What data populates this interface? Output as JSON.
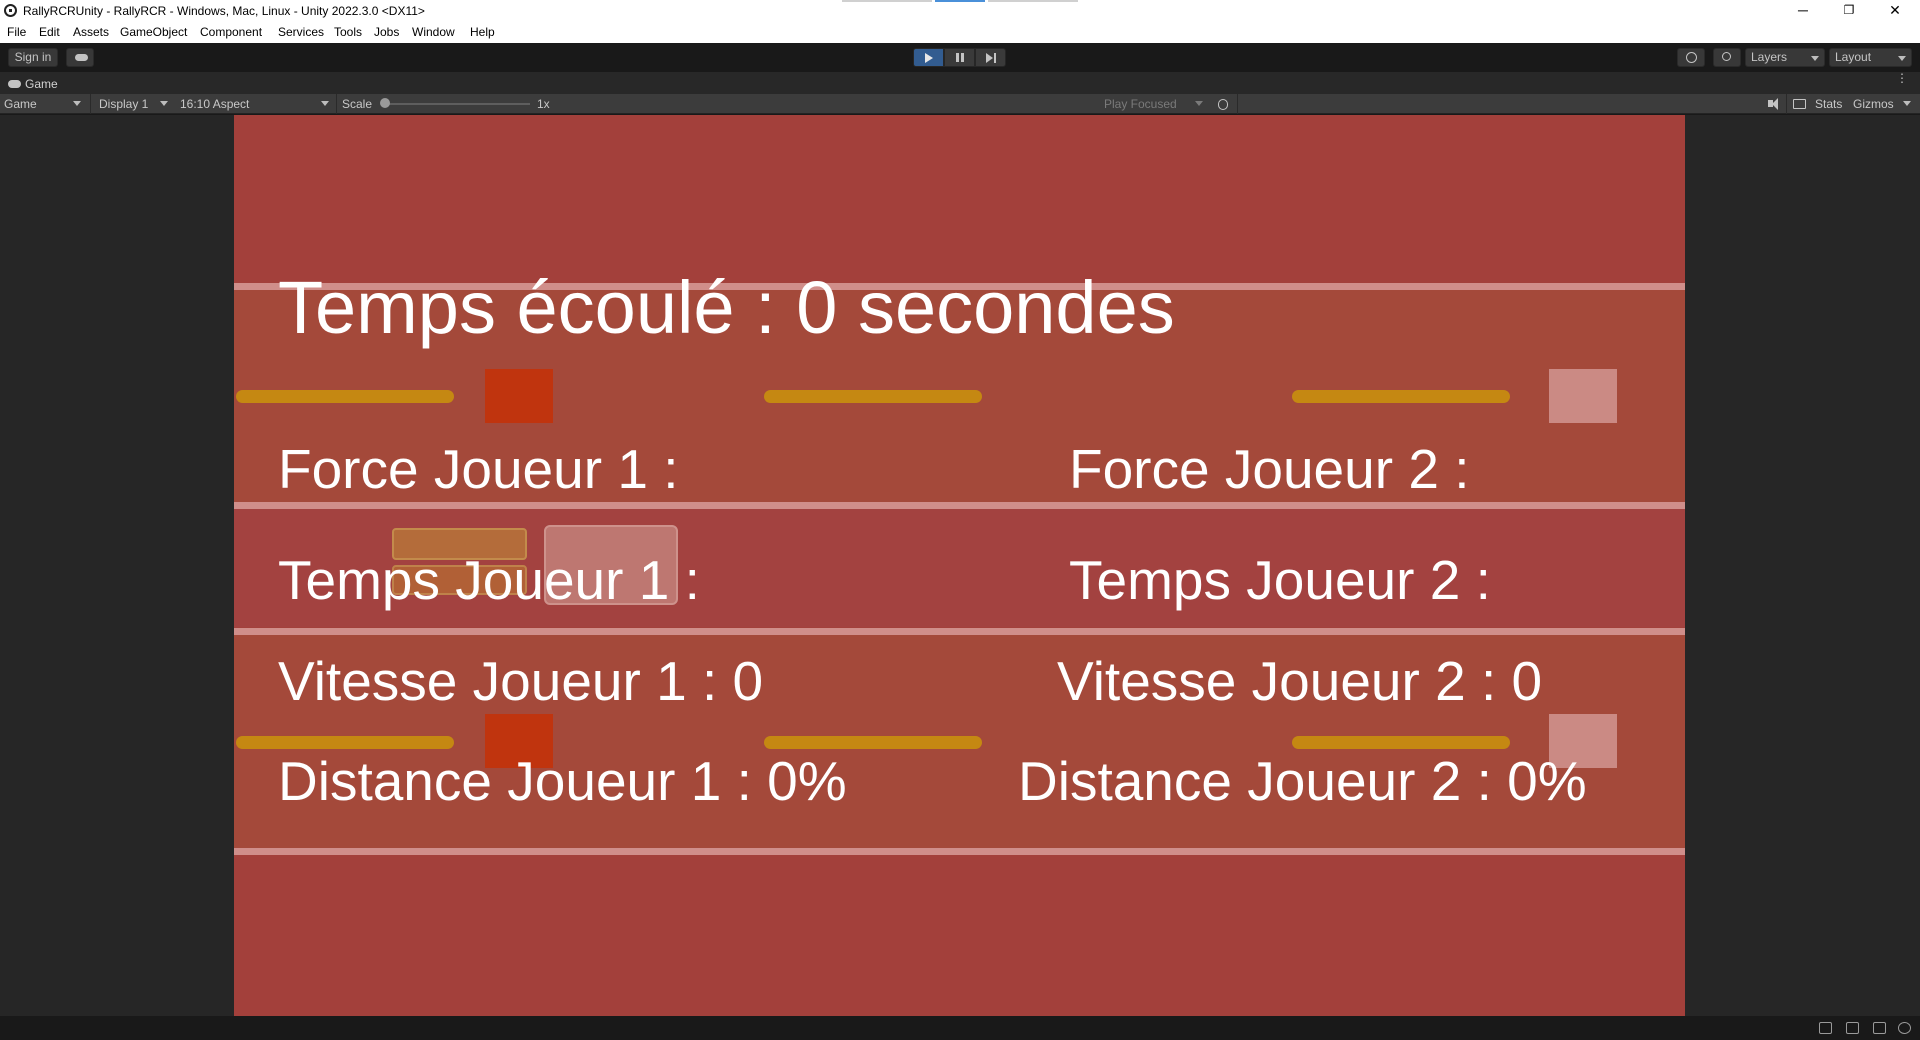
{
  "window": {
    "title": "RallyRCRUnity - RallyRCR - Windows, Mac, Linux - Unity 2022.3.0 <DX11>",
    "minimize_glyph": "─",
    "restore_glyph": "❐",
    "close_glyph": "✕"
  },
  "menu": [
    "File",
    "Edit",
    "Assets",
    "GameObject",
    "Component",
    "Services",
    "Tools",
    "Jobs",
    "Window",
    "Help"
  ],
  "toolbar": {
    "sign_in": "Sign in",
    "layers": "Layers",
    "layout": "Layout",
    "play_state": "playing"
  },
  "game_tab": {
    "label": "Game"
  },
  "game_toolbar": {
    "view": "Game",
    "display": "Display 1",
    "aspect": "16:10 Aspect",
    "scale_label": "Scale",
    "scale_value": "1x",
    "play_focused": "Play Focused",
    "stats": "Stats",
    "gizmos": "Gizmos"
  },
  "game": {
    "elapsed_time": "Temps écoulé : 0 secondes",
    "player1": {
      "force": "Force Joueur 1 :",
      "time": "Temps Joueur 1 :",
      "speed": "Vitesse Joueur 1 : 0",
      "distance": "Distance Joueur 1 : 0%"
    },
    "player2": {
      "force": "Force Joueur 2 :",
      "time": "Temps Joueur 2 :",
      "speed": "Vitesse Joueur 2 : 0",
      "distance": "Distance Joueur 2 : 0%"
    },
    "colors": {
      "background": "#a3403b",
      "band": "#a4493a",
      "line": "#d08e8a",
      "stripe": "#c58812",
      "car1": "#c0340e",
      "car2": "#cb8a84"
    }
  }
}
